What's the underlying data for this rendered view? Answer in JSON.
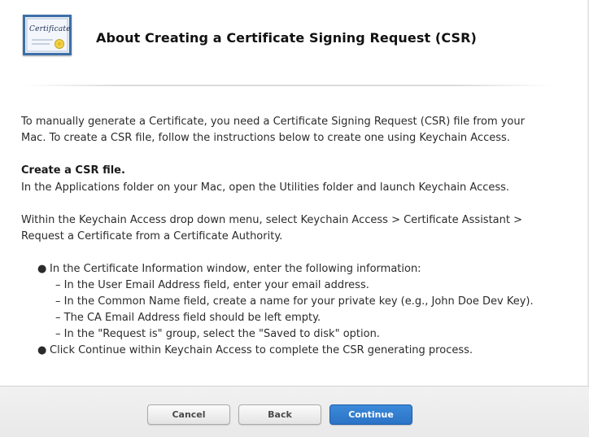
{
  "header": {
    "icon_name": "certificate-icon",
    "icon_text": "Certificate",
    "title": "About Creating a Certificate Signing Request (CSR)"
  },
  "content": {
    "intro_line1": "To manually generate a Certificate, you need a Certificate Signing Request (CSR) file from your",
    "intro_line2": "Mac. To create a CSR file, follow the instructions below to create one using Keychain Access.",
    "section_heading": "Create a CSR file.",
    "step1": "In the Applications folder on your Mac, open the Utilities folder and launch Keychain Access.",
    "step2_line1": "Within the Keychain Access drop down menu, select Keychain Access > Certificate Assistant >",
    "step2_line2": "Request a Certificate from a Certificate Authority.",
    "bullets": [
      {
        "text": "In the Certificate Information window, enter the following information:",
        "subitems": [
          "– In the User Email Address field, enter your email address.",
          "– In the Common Name field, create a name for your private key (e.g., John Doe Dev Key).",
          "– The CA Email Address field should be left empty.",
          "– In the \"Request is\" group, select the \"Saved to disk\" option."
        ]
      },
      {
        "text": "Click Continue within Keychain Access to complete the CSR generating process.",
        "subitems": []
      }
    ]
  },
  "footer": {
    "cancel_label": "Cancel",
    "back_label": "Back",
    "continue_label": "Continue"
  },
  "colors": {
    "primary_button": "#2b73c6",
    "icon_border": "#3d6fa8"
  }
}
